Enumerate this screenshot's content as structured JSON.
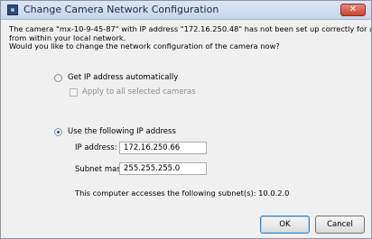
{
  "window": {
    "title": "Change Camera Network Configuration",
    "close_glyph": "✕"
  },
  "message": {
    "line1": "The camera \"mx-10-9-45-87\" with IP address \"172.16.250.48\" has not been set up correctly for access",
    "line2": "from within your local network.",
    "line3": "Would you like to change the network configuration of the camera now?"
  },
  "options": {
    "auto_ip": {
      "label": "Get IP address automatically",
      "selected": false
    },
    "apply_all": {
      "label": "Apply to all selected cameras",
      "checked": false,
      "enabled": false
    },
    "manual_ip": {
      "label": "Use the following IP address",
      "selected": true
    }
  },
  "fields": {
    "ip_address": {
      "label": "IP address:",
      "value": "172.16.250.66"
    },
    "subnet_mask": {
      "label": "Subnet mask:",
      "value": "255.255.255.0"
    }
  },
  "info_text": "This computer accesses the following subnet(s): 10.0.2.0",
  "buttons": {
    "ok": "OK",
    "cancel": "Cancel"
  },
  "colors": {
    "accent": "#1a4fa3",
    "close_button": "#c8442f"
  }
}
